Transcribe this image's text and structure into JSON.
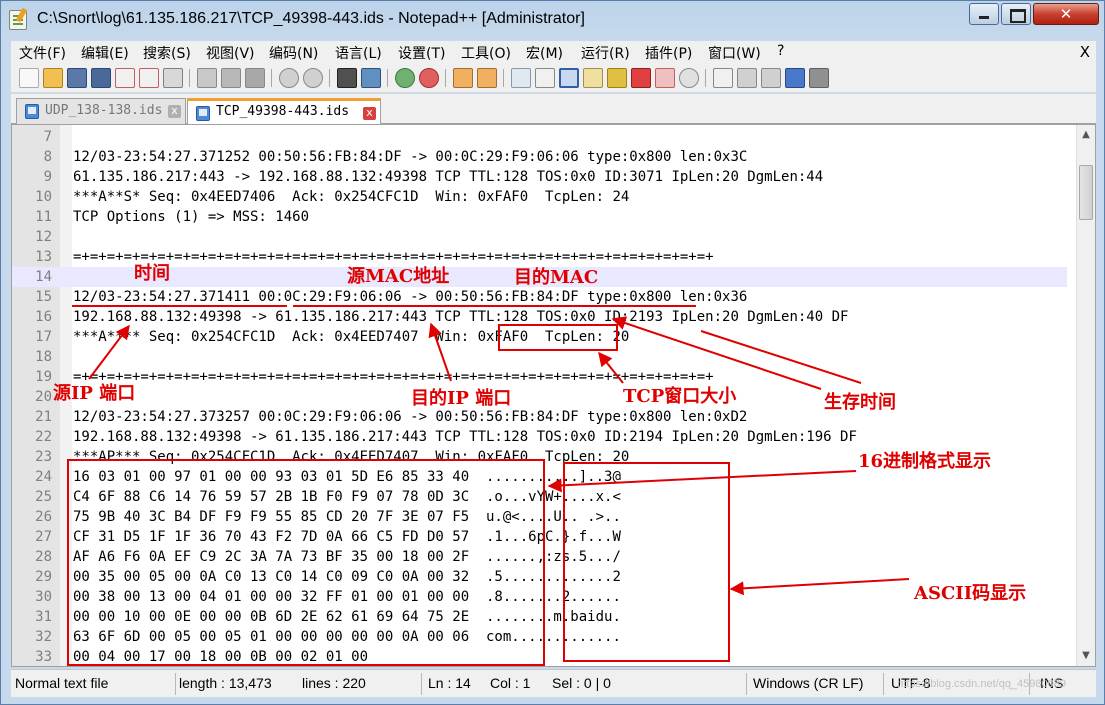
{
  "window": {
    "title": "C:\\Snort\\log\\61.135.186.217\\TCP_49398-443.ids - Notepad++ [Administrator]",
    "close_glyph": "✕"
  },
  "menu": {
    "items": [
      "文件(F)",
      "编辑(E)",
      "搜索(S)",
      "视图(V)",
      "编码(N)",
      "语言(L)",
      "设置(T)",
      "工具(O)",
      "宏(M)",
      "运行(R)",
      "插件(P)",
      "窗口(W)",
      "?"
    ],
    "close": "X"
  },
  "tabs": [
    {
      "label": "UDP_138-138.ids",
      "active": false
    },
    {
      "label": "TCP_49398-443.ids",
      "active": true
    }
  ],
  "tab_close_glyph": "x",
  "editor": {
    "lines": [
      {
        "n": "7",
        "text": ""
      },
      {
        "n": "8",
        "text": "12/03-23:54:27.371252 00:50:56:FB:84:DF -> 00:0C:29:F9:06:06 type:0x800 len:0x3C"
      },
      {
        "n": "9",
        "text": "61.135.186.217:443 -> 192.168.88.132:49398 TCP TTL:128 TOS:0x0 ID:3071 IpLen:20 DgmLen:44"
      },
      {
        "n": "10",
        "text": "***A**S* Seq: 0x4EED7406  Ack: 0x254CFC1D  Win: 0xFAF0  TcpLen: 24"
      },
      {
        "n": "11",
        "text": "TCP Options (1) => MSS: 1460"
      },
      {
        "n": "12",
        "text": ""
      },
      {
        "n": "13",
        "text": "=+=+=+=+=+=+=+=+=+=+=+=+=+=+=+=+=+=+=+=+=+=+=+=+=+=+=+=+=+=+=+=+=+=+=+=+=+=+"
      },
      {
        "n": "14",
        "text": ""
      },
      {
        "n": "15",
        "text": "12/03-23:54:27.371411 00:0C:29:F9:06:06 -> 00:50:56:FB:84:DF type:0x800 len:0x36"
      },
      {
        "n": "16",
        "text": "192.168.88.132:49398 -> 61.135.186.217:443 TCP TTL:128 TOS:0x0 ID:2193 IpLen:20 DgmLen:40 DF"
      },
      {
        "n": "17",
        "text": "***A**** Seq: 0x254CFC1D  Ack: 0x4EED7407  Win: 0xFAF0  TcpLen: 20"
      },
      {
        "n": "18",
        "text": ""
      },
      {
        "n": "19",
        "text": "=+=+=+=+=+=+=+=+=+=+=+=+=+=+=+=+=+=+=+=+=+=+=+=+=+=+=+=+=+=+=+=+=+=+=+=+=+=+"
      },
      {
        "n": "20",
        "text": ""
      },
      {
        "n": "21",
        "text": "12/03-23:54:27.373257 00:0C:29:F9:06:06 -> 00:50:56:FB:84:DF type:0x800 len:0xD2"
      },
      {
        "n": "22",
        "text": "192.168.88.132:49398 -> 61.135.186.217:443 TCP TTL:128 TOS:0x0 ID:2194 IpLen:20 DgmLen:196 DF"
      },
      {
        "n": "23",
        "text": "***AP*** Seq: 0x254CFC1D  Ack: 0x4EED7407  Win: 0xFAF0  TcpLen: 20"
      },
      {
        "n": "24",
        "text": "16 03 01 00 97 01 00 00 93 03 01 5D E6 85 33 40  ...........]..3@"
      },
      {
        "n": "25",
        "text": "C4 6F 88 C6 14 76 59 57 2B 1B F0 F9 07 78 0D 3C  .o...vYW+....x.<"
      },
      {
        "n": "26",
        "text": "75 9B 40 3C B4 DF F9 F9 55 85 CD 20 7F 3E 07 F5  u.@<....U.. .>.."
      },
      {
        "n": "27",
        "text": "CF 31 D5 1F 1F 36 70 43 F2 7D 0A 66 C5 FD D0 57  .1...6pC.}.f...W"
      },
      {
        "n": "28",
        "text": "AF A6 F6 0A EF C9 2C 3A 7A 73 BF 35 00 18 00 2F  ......,:zs.5.../"
      },
      {
        "n": "29",
        "text": "00 35 00 05 00 0A C0 13 C0 14 C0 09 C0 0A 00 32  .5.............2"
      },
      {
        "n": "30",
        "text": "00 38 00 13 00 04 01 00 00 32 FF 01 00 01 00 00  .8.......2......"
      },
      {
        "n": "31",
        "text": "00 00 10 00 0E 00 00 0B 6D 2E 62 61 69 64 75 2E  ........m.baidu."
      },
      {
        "n": "32",
        "text": "63 6F 6D 00 05 00 05 01 00 00 00 00 00 0A 00 06  com............."
      },
      {
        "n": "33",
        "text": "00 04 00 17 00 18 00 0B 00 02 01 00"
      }
    ],
    "current_line": "14"
  },
  "annotations": {
    "time": "时间",
    "src_mac": "源MAC地址",
    "dst_mac": "目的MAC",
    "src_ip_port": "源IP 端口",
    "dst_ip_port": "目的IP 端口",
    "tcp_window": "TCP窗口大小",
    "ttl": "生存时间",
    "hex": "16进制格式显示",
    "ascii": "ASCII码显示",
    "color": "#e00000"
  },
  "status": {
    "file_type": "Normal text file",
    "length": "length : 13,473",
    "lines": "lines : 220",
    "ln": "Ln : 14",
    "col": "Col : 1",
    "sel": "Sel : 0 | 0",
    "eol": "Windows (CR LF)",
    "encoding": "UTF-8",
    "mode": "INS",
    "watermark": "https://blog.csdn.net/qq_45980089"
  },
  "colors": {
    "tab_accent": "#f0a030",
    "current_line_bg": "#e8e8ff"
  }
}
